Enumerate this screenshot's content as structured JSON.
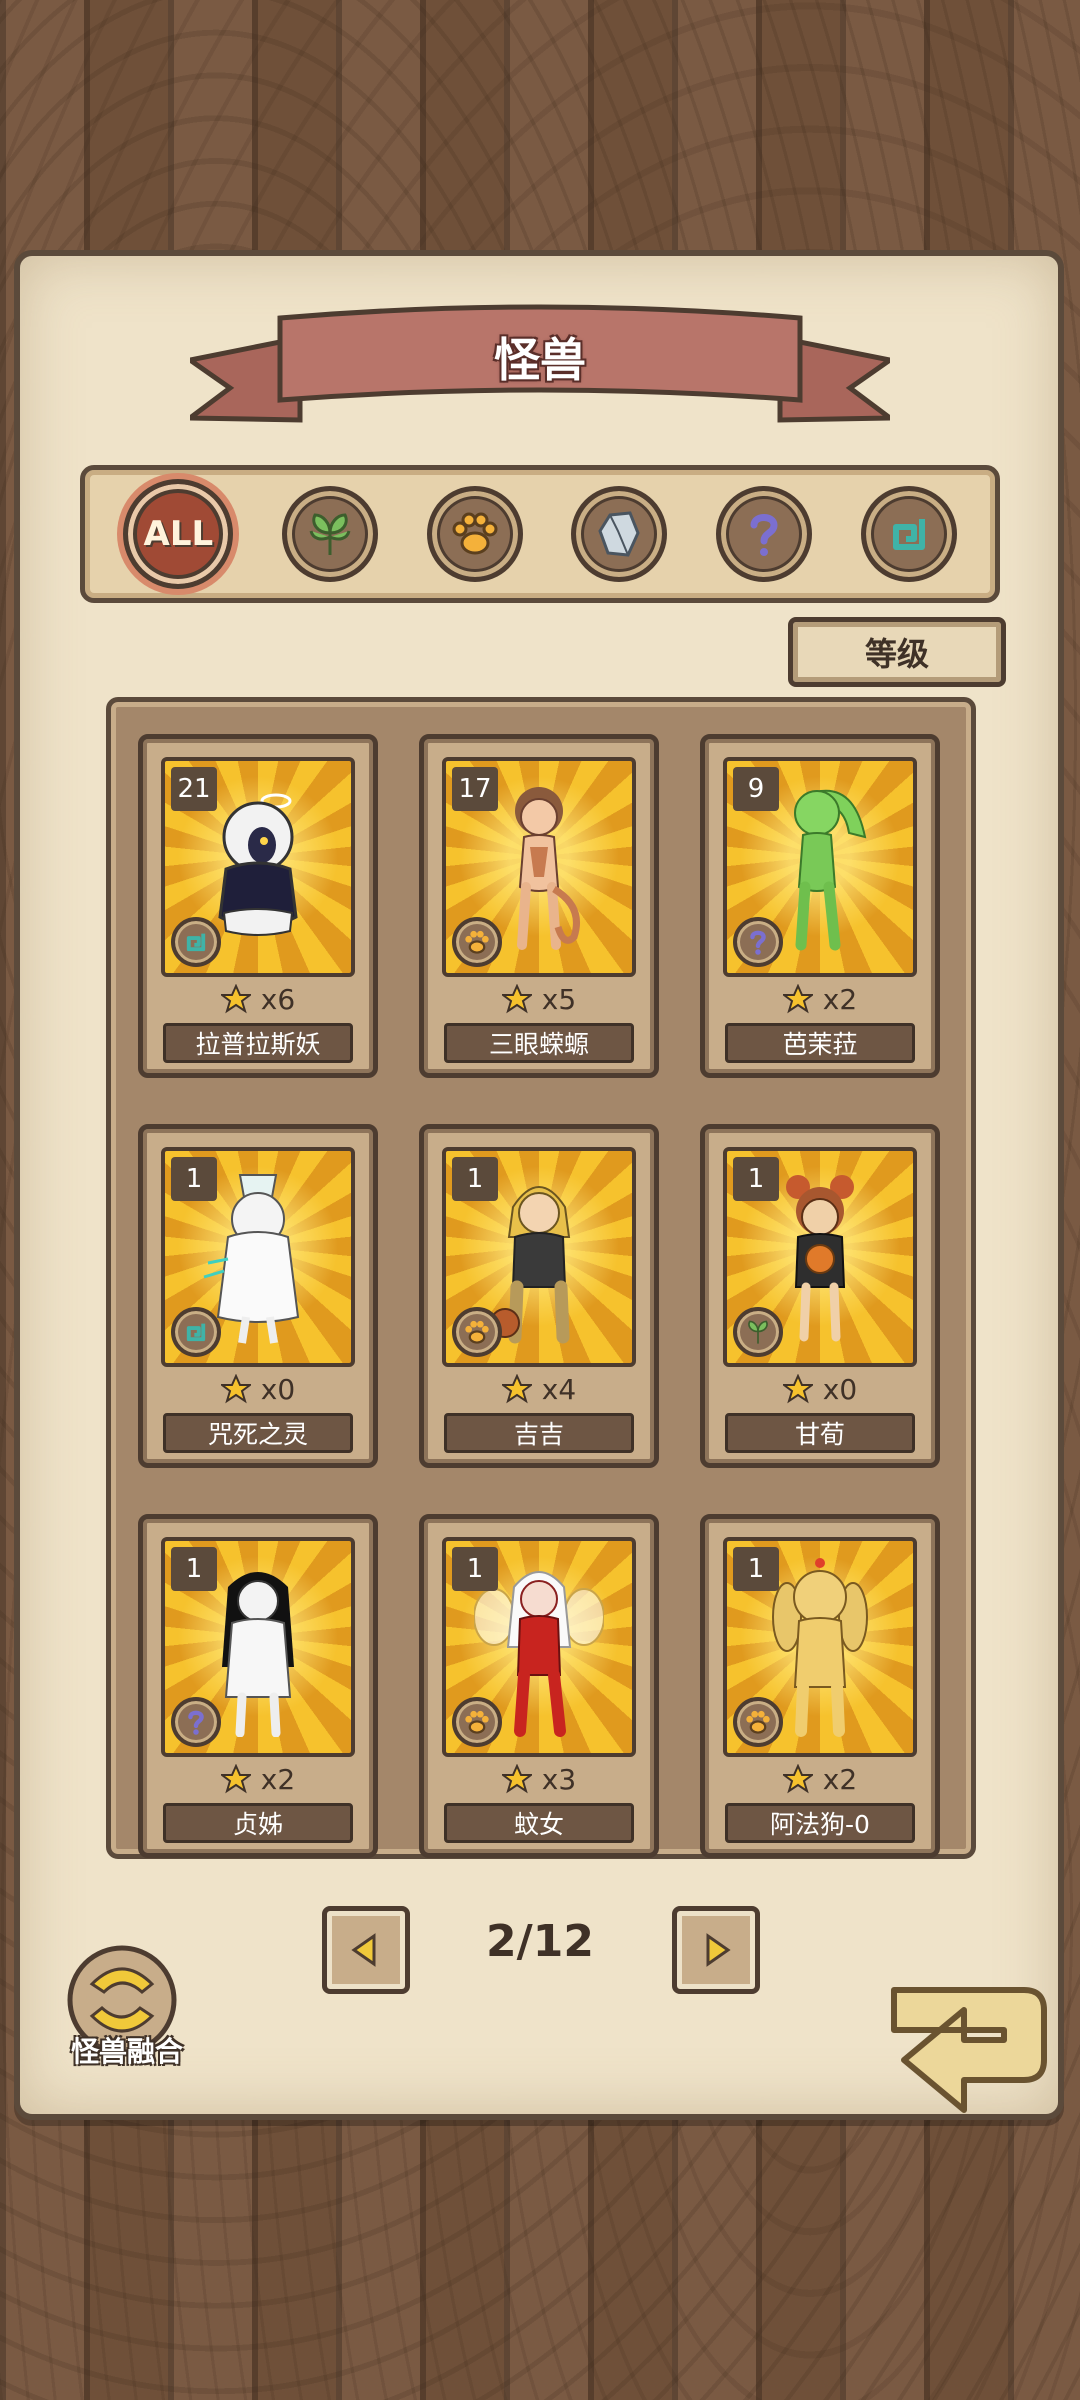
{
  "header": {
    "title": "怪兽"
  },
  "filters": [
    {
      "id": "all",
      "label": "ALL",
      "icon": "all-icon",
      "active": true
    },
    {
      "id": "plant",
      "icon": "leaf-icon"
    },
    {
      "id": "beast",
      "icon": "paw-icon"
    },
    {
      "id": "mineral",
      "icon": "crystal-icon"
    },
    {
      "id": "unknown",
      "icon": "question-icon"
    },
    {
      "id": "spirit",
      "icon": "swirl-icon"
    }
  ],
  "sort": {
    "label": "等级"
  },
  "cards": [
    {
      "level": "21",
      "stars": "x6",
      "name": "拉普拉斯妖",
      "type_icon": "swirl-icon"
    },
    {
      "level": "17",
      "stars": "x5",
      "name": "三眼蝾螈",
      "type_icon": "paw-icon"
    },
    {
      "level": "9",
      "stars": "x2",
      "name": "芭茉菈",
      "type_icon": "question-icon"
    },
    {
      "level": "1",
      "stars": "x0",
      "name": "咒死之灵",
      "type_icon": "swirl-icon"
    },
    {
      "level": "1",
      "stars": "x4",
      "name": "吉吉",
      "type_icon": "paw-icon"
    },
    {
      "level": "1",
      "stars": "x0",
      "name": "甘荀",
      "type_icon": "leaf-icon"
    },
    {
      "level": "1",
      "stars": "x2",
      "name": "贞姊",
      "type_icon": "question-icon"
    },
    {
      "level": "1",
      "stars": "x3",
      "name": "蚊女",
      "type_icon": "paw-icon"
    },
    {
      "level": "1",
      "stars": "x2",
      "name": "阿法狗-0",
      "type_icon": "paw-icon"
    }
  ],
  "pagination": {
    "text": "2/12"
  },
  "fusion": {
    "label": "怪兽融合"
  },
  "colors": {
    "paper": "#efe3c9",
    "ribbon": "#b8756a",
    "card_bg": "#f6c22d",
    "frame": "#4d3c30"
  }
}
